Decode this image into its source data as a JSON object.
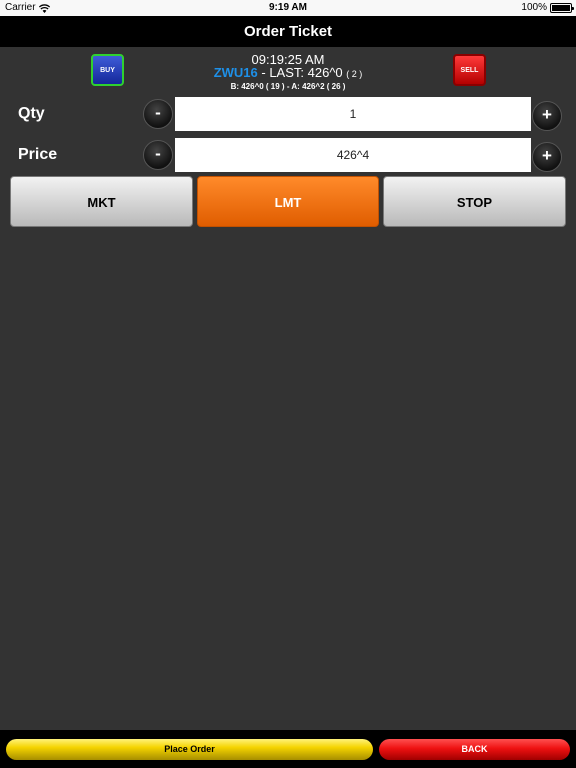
{
  "status_bar": {
    "carrier": "Carrier",
    "time": "9:19 AM",
    "battery": "100%"
  },
  "nav": {
    "title": "Order Ticket"
  },
  "quote": {
    "buy_label": "BUY",
    "sell_label": "SELL",
    "time": "09:19:25 AM",
    "symbol": "ZWU16",
    "last_prefix": " - LAST: ",
    "last": "426^0",
    "last_size": "( 2 )",
    "bid_ask": "B: 426^0 ( 19 ) - A: 426^2 ( 26 )"
  },
  "qty": {
    "label": "Qty",
    "value": "1",
    "minus": "-",
    "plus": "+"
  },
  "price": {
    "label": "Price",
    "value": "426^4",
    "minus": "-",
    "plus": "+"
  },
  "order_types": {
    "mkt": "MKT",
    "lmt": "LMT",
    "stop": "STOP",
    "selected": "LMT"
  },
  "footer": {
    "place_order": "Place Order",
    "back": "BACK"
  },
  "colors": {
    "buy": "#14279a",
    "sell": "#cc0000",
    "active": "#f07010",
    "symbol": "#1e90e8"
  }
}
